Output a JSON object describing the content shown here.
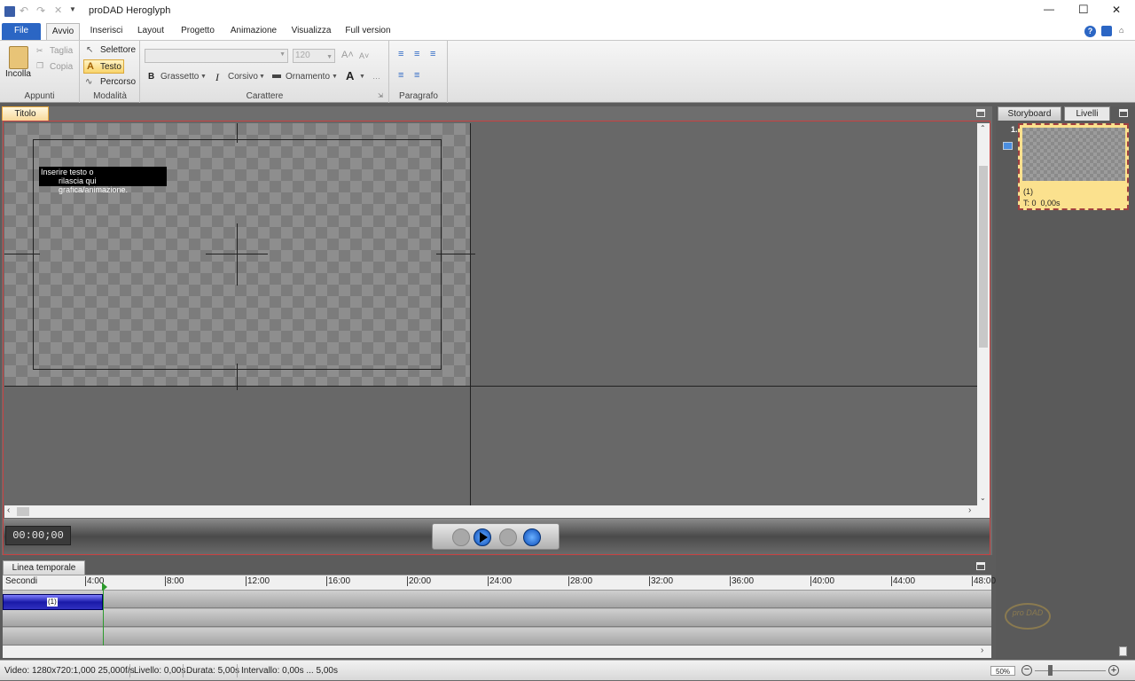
{
  "window": {
    "title": "proDAD Heroglyph",
    "minimize_glyph": "—",
    "maximize_glyph": "☐",
    "close_glyph": "✕"
  },
  "ribbon_tabs": [
    {
      "label": "File"
    },
    {
      "label": "Avvio"
    },
    {
      "label": "Inserisci"
    },
    {
      "label": "Layout"
    },
    {
      "label": "Progetto"
    },
    {
      "label": "Animazione"
    },
    {
      "label": "Visualizza"
    },
    {
      "label": "Full version"
    }
  ],
  "ribbon": {
    "appunti": {
      "paste": "Incolla",
      "cut": "Taglia",
      "copy": "Copia",
      "label": "Appunti"
    },
    "modalita": {
      "selector": "Selettore",
      "text": "Testo",
      "path": "Percorso",
      "label": "Modalità"
    },
    "carattere": {
      "font_value": "",
      "size_value": "120",
      "bold": "Grassetto",
      "italic": "Corsivo",
      "ornament": "Ornamento",
      "label": "Carattere"
    },
    "paragrafo": {
      "label": "Paragrafo"
    }
  },
  "panels": {
    "titolo_tab": "Titolo",
    "storyboard_tab": "Storyboard",
    "livelli_tab": "Livelli",
    "timeline_tab": "Linea temporale"
  },
  "canvas": {
    "placeholder_line1": "Inserire testo o",
    "placeholder_line2": "rilascia qui grafica/animazione."
  },
  "transport": {
    "timecode": "00:00;00"
  },
  "storyboard": {
    "index": "1.",
    "item_name": "(1)",
    "item_time": "T: 0  0,00s",
    "logo_text": "pro DAD"
  },
  "timeline": {
    "unit": "Secondi",
    "ticks": [
      "4:00",
      "8:00",
      "12:00",
      "16:00",
      "20:00",
      "24:00",
      "28:00",
      "32:00",
      "36:00",
      "40:00",
      "44:00",
      "48:00"
    ],
    "clip_label": "(1)"
  },
  "status": {
    "video": "Video: 1280x720:1,000  25,000f/s",
    "livello": "Livello: 0,00s",
    "durata": "Durata: 5,00s",
    "intervallo": "Intervallo: 0,00s ... 5,00s",
    "zoom": "50%"
  }
}
